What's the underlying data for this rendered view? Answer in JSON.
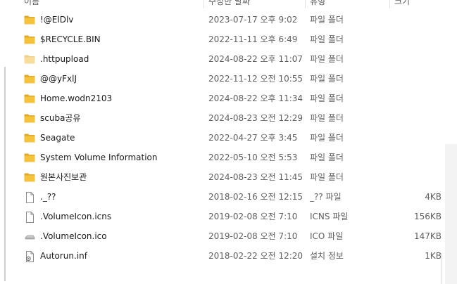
{
  "header": {
    "name": "이름",
    "date": "수정한 날짜",
    "type": "유형",
    "size": "크기"
  },
  "rows": [
    {
      "name": "!@ElDlv",
      "date": "2023-07-17 오후 9:02",
      "type": "파일 폴더",
      "size": "",
      "icon": "folder-icon"
    },
    {
      "name": "$RECYCLE.BIN",
      "date": "2022-11-11 오후 6:49",
      "type": "파일 폴더",
      "size": "",
      "icon": "folder-icon"
    },
    {
      "name": ".httpupload",
      "date": "2024-08-22 오후 11:07",
      "type": "파일 폴더",
      "size": "",
      "icon": "folder-icon-hidden"
    },
    {
      "name": "@@yFxlJ",
      "date": "2022-11-12 오전 10:55",
      "type": "파일 폴더",
      "size": "",
      "icon": "folder-icon"
    },
    {
      "name": "Home.wodn2103",
      "date": "2024-08-22 오후 11:34",
      "type": "파일 폴더",
      "size": "",
      "icon": "folder-icon"
    },
    {
      "name": "scuba공유",
      "date": "2024-08-23 오전 12:29",
      "type": "파일 폴더",
      "size": "",
      "icon": "folder-icon"
    },
    {
      "name": "Seagate",
      "date": "2022-04-27 오후 3:45",
      "type": "파일 폴더",
      "size": "",
      "icon": "folder-icon"
    },
    {
      "name": "System Volume Information",
      "date": "2022-05-10 오전 5:53",
      "type": "파일 폴더",
      "size": "",
      "icon": "folder-icon"
    },
    {
      "name": "원본사진보관",
      "date": "2024-08-23 오전 11:45",
      "type": "파일 폴더",
      "size": "",
      "icon": "folder-icon"
    },
    {
      "name": "._??",
      "date": "2018-02-16 오전 12:15",
      "type": "_?? 파일",
      "size": "4KB",
      "icon": "file-icon"
    },
    {
      "name": ".VolumeIcon.icns",
      "date": "2019-02-08 오전 7:10",
      "type": "ICNS 파일",
      "size": "156KB",
      "icon": "file-icon"
    },
    {
      "name": ".VolumeIcon.ico",
      "date": "2019-02-08 오전 7:10",
      "type": "ICO 파일",
      "size": "147KB",
      "icon": "drive-icon"
    },
    {
      "name": "Autorun.inf",
      "date": "2018-02-22 오전 12:20",
      "type": "설치 정보",
      "size": "1KB",
      "icon": "settings-file-icon"
    }
  ],
  "colors": {
    "folder": "#F5C33B",
    "folder_dark": "#E0A82B",
    "folder_hidden": "#F8DD9A",
    "secondary_text": "#5F5F5F"
  }
}
